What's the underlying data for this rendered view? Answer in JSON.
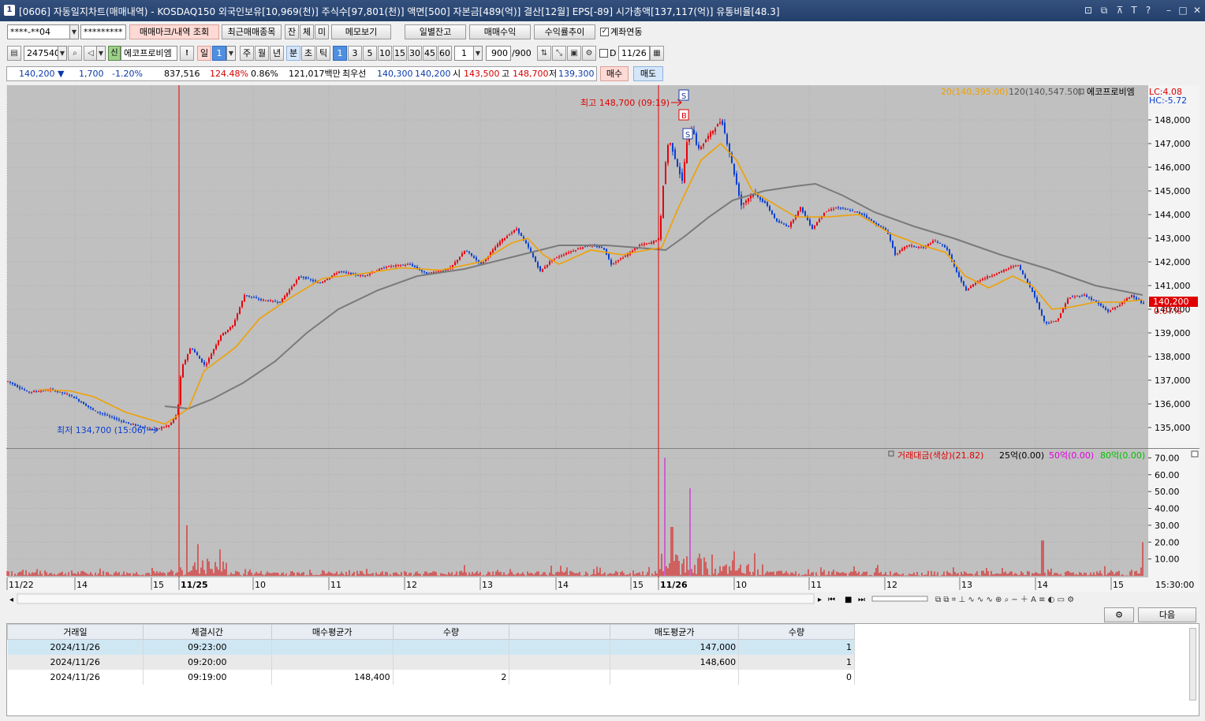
{
  "window": {
    "icon_label": "1",
    "title": "[0606] 자동일지차트(매매내역) - KOSDAQ150 외국인보유[10,969(천)] 주식수[97,801(천)] 액면[500] 자본금[489(억)] 결산[12월] EPS[-89] 시가총액[137,117(억)] 유통비율[48.3]",
    "buttons": [
      "⊡",
      "⧉",
      "⊼",
      "T",
      "?",
      "–",
      "□",
      "✕"
    ]
  },
  "row1": {
    "account": "****-**04",
    "password": "*********",
    "mark_button": "매매마크/내역 조회",
    "recent_button": "최근매매종목",
    "tab_jan": "잔",
    "tab_che": "체",
    "tab_mi": "미",
    "memo_button": "메모보기",
    "daily_balance": "일별잔고",
    "trade_profit": "매매수익",
    "return_trend": "수익률추이",
    "link_label": "계좌연동"
  },
  "row2": {
    "code": "247540",
    "credit_badge": "신",
    "stock_name": "에코프로비엠",
    "excl": "!",
    "period_day": "일",
    "period_num": "1",
    "week": "주",
    "month": "월",
    "year": "년",
    "minute": "분",
    "second": "초",
    "tick": "틱",
    "intervals": [
      "1",
      "3",
      "5",
      "10",
      "15",
      "30",
      "45",
      "60"
    ],
    "custom_val": "1",
    "count": "900",
    "count_total": "/900",
    "date_label": "D",
    "date_val": "11/26"
  },
  "row3": {
    "price": "140,200 ▼",
    "change": "1,700",
    "rate": "-1.20%",
    "volume": "837,516",
    "vol_ratio": "124.48%",
    "turnover": "0.86%",
    "amount": "121,017백만",
    "best_label": "최우선",
    "ask": "140,300",
    "bid": "140,200",
    "open_label": "시",
    "open": "143,500",
    "high_label": "고",
    "high": "148,700",
    "low_label": "저",
    "low": "139,300",
    "buy_button": "매수",
    "sell_button": "매도"
  },
  "legend": {
    "ma20": "20(140,395.00)",
    "ma120": "120(140,547.50)",
    "name": "에코프로비엠",
    "lc": "LC:4.08",
    "hc": "HC:-5.72",
    "vol_title": "거래대금(색상)(21.82)",
    "v25": "25억(0.00)",
    "v50": "50억(0.00)",
    "v80": "80억(0.00)",
    "close_tag": "140,200",
    "close_pct": "0.07%",
    "time": "15:30:00"
  },
  "annotations": {
    "high": "최고 148,700 (09:19)",
    "low": "최저 134,700 (15:06)",
    "marks": [
      "S",
      "B",
      "S"
    ]
  },
  "chart_data": {
    "type": "candlestick",
    "price_axis": {
      "ticks": [
        "148,000",
        "147,000",
        "146,000",
        "145,000",
        "144,000",
        "143,000",
        "142,000",
        "141,000",
        "140,000",
        "139,000",
        "138,000",
        "137,000",
        "136,000",
        "135,000"
      ],
      "range": [
        134400,
        149200
      ]
    },
    "volume_axis": {
      "ticks": [
        "70.00",
        "60.00",
        "50.00",
        "40.00",
        "30.00",
        "20.00",
        "10.00"
      ],
      "range": [
        0,
        73
      ]
    },
    "x_labels": [
      "11/22",
      "14",
      "15",
      "11/25",
      "10",
      "11",
      "12",
      "13",
      "14",
      "15",
      "11/26",
      "10",
      "11",
      "12",
      "13",
      "14",
      "15"
    ],
    "close_path": [
      [
        0,
        136950
      ],
      [
        25,
        136500
      ],
      [
        55,
        136600
      ],
      [
        80,
        136350
      ],
      [
        110,
        135700
      ],
      [
        150,
        135200
      ],
      [
        185,
        134900
      ],
      [
        205,
        135100
      ],
      [
        215,
        135600
      ],
      [
        220,
        137500
      ],
      [
        232,
        138400
      ],
      [
        250,
        137600
      ],
      [
        270,
        138900
      ],
      [
        285,
        139300
      ],
      [
        300,
        140600
      ],
      [
        320,
        140400
      ],
      [
        345,
        140300
      ],
      [
        370,
        141400
      ],
      [
        395,
        141100
      ],
      [
        420,
        141600
      ],
      [
        450,
        141400
      ],
      [
        480,
        141800
      ],
      [
        510,
        141900
      ],
      [
        530,
        141500
      ],
      [
        560,
        141700
      ],
      [
        580,
        142500
      ],
      [
        600,
        141900
      ],
      [
        625,
        142900
      ],
      [
        645,
        143400
      ],
      [
        660,
        142600
      ],
      [
        675,
        141600
      ],
      [
        690,
        142100
      ],
      [
        710,
        142400
      ],
      [
        735,
        142700
      ],
      [
        755,
        142600
      ],
      [
        765,
        141900
      ],
      [
        785,
        142300
      ],
      [
        800,
        142700
      ],
      [
        815,
        142800
      ],
      [
        826,
        143000
      ],
      [
        832,
        145700
      ],
      [
        838,
        147200
      ],
      [
        845,
        146500
      ],
      [
        855,
        145400
      ],
      [
        862,
        147300
      ],
      [
        868,
        147700
      ],
      [
        875,
        146700
      ],
      [
        890,
        147400
      ],
      [
        905,
        148000
      ],
      [
        915,
        146600
      ],
      [
        930,
        144400
      ],
      [
        945,
        144900
      ],
      [
        960,
        144500
      ],
      [
        975,
        143700
      ],
      [
        990,
        143500
      ],
      [
        1005,
        144300
      ],
      [
        1020,
        143400
      ],
      [
        1035,
        144100
      ],
      [
        1050,
        144300
      ],
      [
        1065,
        144200
      ],
      [
        1085,
        144000
      ],
      [
        1100,
        143600
      ],
      [
        1115,
        143300
      ],
      [
        1125,
        142300
      ],
      [
        1140,
        142700
      ],
      [
        1160,
        142600
      ],
      [
        1175,
        142900
      ],
      [
        1190,
        142600
      ],
      [
        1205,
        141400
      ],
      [
        1215,
        140800
      ],
      [
        1230,
        141200
      ],
      [
        1245,
        141400
      ],
      [
        1260,
        141600
      ],
      [
        1280,
        141900
      ],
      [
        1300,
        140700
      ],
      [
        1315,
        139400
      ],
      [
        1330,
        139500
      ],
      [
        1345,
        140500
      ],
      [
        1365,
        140600
      ],
      [
        1380,
        140300
      ],
      [
        1395,
        139900
      ],
      [
        1410,
        140200
      ],
      [
        1425,
        140600
      ],
      [
        1440,
        140200
      ]
    ],
    "ma20_path": [
      [
        40,
        136600
      ],
      [
        80,
        136550
      ],
      [
        110,
        136300
      ],
      [
        150,
        135650
      ],
      [
        200,
        135150
      ],
      [
        230,
        135800
      ],
      [
        250,
        137400
      ],
      [
        290,
        138400
      ],
      [
        320,
        139600
      ],
      [
        360,
        140500
      ],
      [
        400,
        141300
      ],
      [
        450,
        141500
      ],
      [
        500,
        141750
      ],
      [
        550,
        141650
      ],
      [
        600,
        142000
      ],
      [
        640,
        142800
      ],
      [
        660,
        143000
      ],
      [
        680,
        142300
      ],
      [
        700,
        141900
      ],
      [
        740,
        142500
      ],
      [
        780,
        142300
      ],
      [
        810,
        142500
      ],
      [
        830,
        142600
      ],
      [
        850,
        144200
      ],
      [
        880,
        146300
      ],
      [
        905,
        147000
      ],
      [
        925,
        146300
      ],
      [
        945,
        145000
      ],
      [
        975,
        144400
      ],
      [
        1000,
        143900
      ],
      [
        1040,
        143900
      ],
      [
        1080,
        144000
      ],
      [
        1120,
        143200
      ],
      [
        1160,
        142700
      ],
      [
        1190,
        142400
      ],
      [
        1215,
        141400
      ],
      [
        1245,
        140900
      ],
      [
        1275,
        141400
      ],
      [
        1300,
        141000
      ],
      [
        1325,
        140000
      ],
      [
        1350,
        140100
      ],
      [
        1380,
        140300
      ],
      [
        1410,
        140300
      ],
      [
        1440,
        140400
      ]
    ],
    "ma120_path": [
      [
        200,
        135900
      ],
      [
        230,
        135800
      ],
      [
        260,
        136200
      ],
      [
        300,
        136900
      ],
      [
        340,
        137800
      ],
      [
        380,
        139000
      ],
      [
        420,
        140000
      ],
      [
        470,
        140800
      ],
      [
        520,
        141400
      ],
      [
        580,
        141700
      ],
      [
        640,
        142200
      ],
      [
        700,
        142700
      ],
      [
        760,
        142700
      ],
      [
        800,
        142600
      ],
      [
        835,
        142500
      ],
      [
        860,
        143100
      ],
      [
        890,
        143900
      ],
      [
        920,
        144600
      ],
      [
        960,
        145000
      ],
      [
        1000,
        145200
      ],
      [
        1025,
        145300
      ],
      [
        1060,
        144800
      ],
      [
        1100,
        144100
      ],
      [
        1150,
        143500
      ],
      [
        1200,
        143000
      ],
      [
        1260,
        142300
      ],
      [
        1320,
        141700
      ],
      [
        1380,
        141000
      ],
      [
        1440,
        140600
      ]
    ],
    "volume_spikes": [
      [
        228,
        30
      ],
      [
        834,
        70
      ],
      [
        843,
        29
      ],
      [
        866,
        52
      ],
      [
        1313,
        21
      ],
      [
        1441,
        20
      ]
    ]
  },
  "table": {
    "headers": [
      "거래일",
      "체결시간",
      "매수평균가",
      "수량",
      "",
      "매도평균가",
      "수량"
    ],
    "rows": [
      [
        "2024/11/26",
        "09:23:00",
        "",
        "",
        "",
        "147,000",
        "1"
      ],
      [
        "2024/11/26",
        "09:20:00",
        "",
        "",
        "",
        "148,600",
        "1"
      ],
      [
        "2024/11/26",
        "09:19:00",
        "148,400",
        "2",
        "",
        "",
        "0"
      ]
    ],
    "next_button": "다음"
  },
  "colors": {
    "up": "#e8000b",
    "down": "#0b3fd0",
    "ma20": "#f0a000",
    "ma120": "#808080",
    "bg": "#c0c0c0"
  }
}
